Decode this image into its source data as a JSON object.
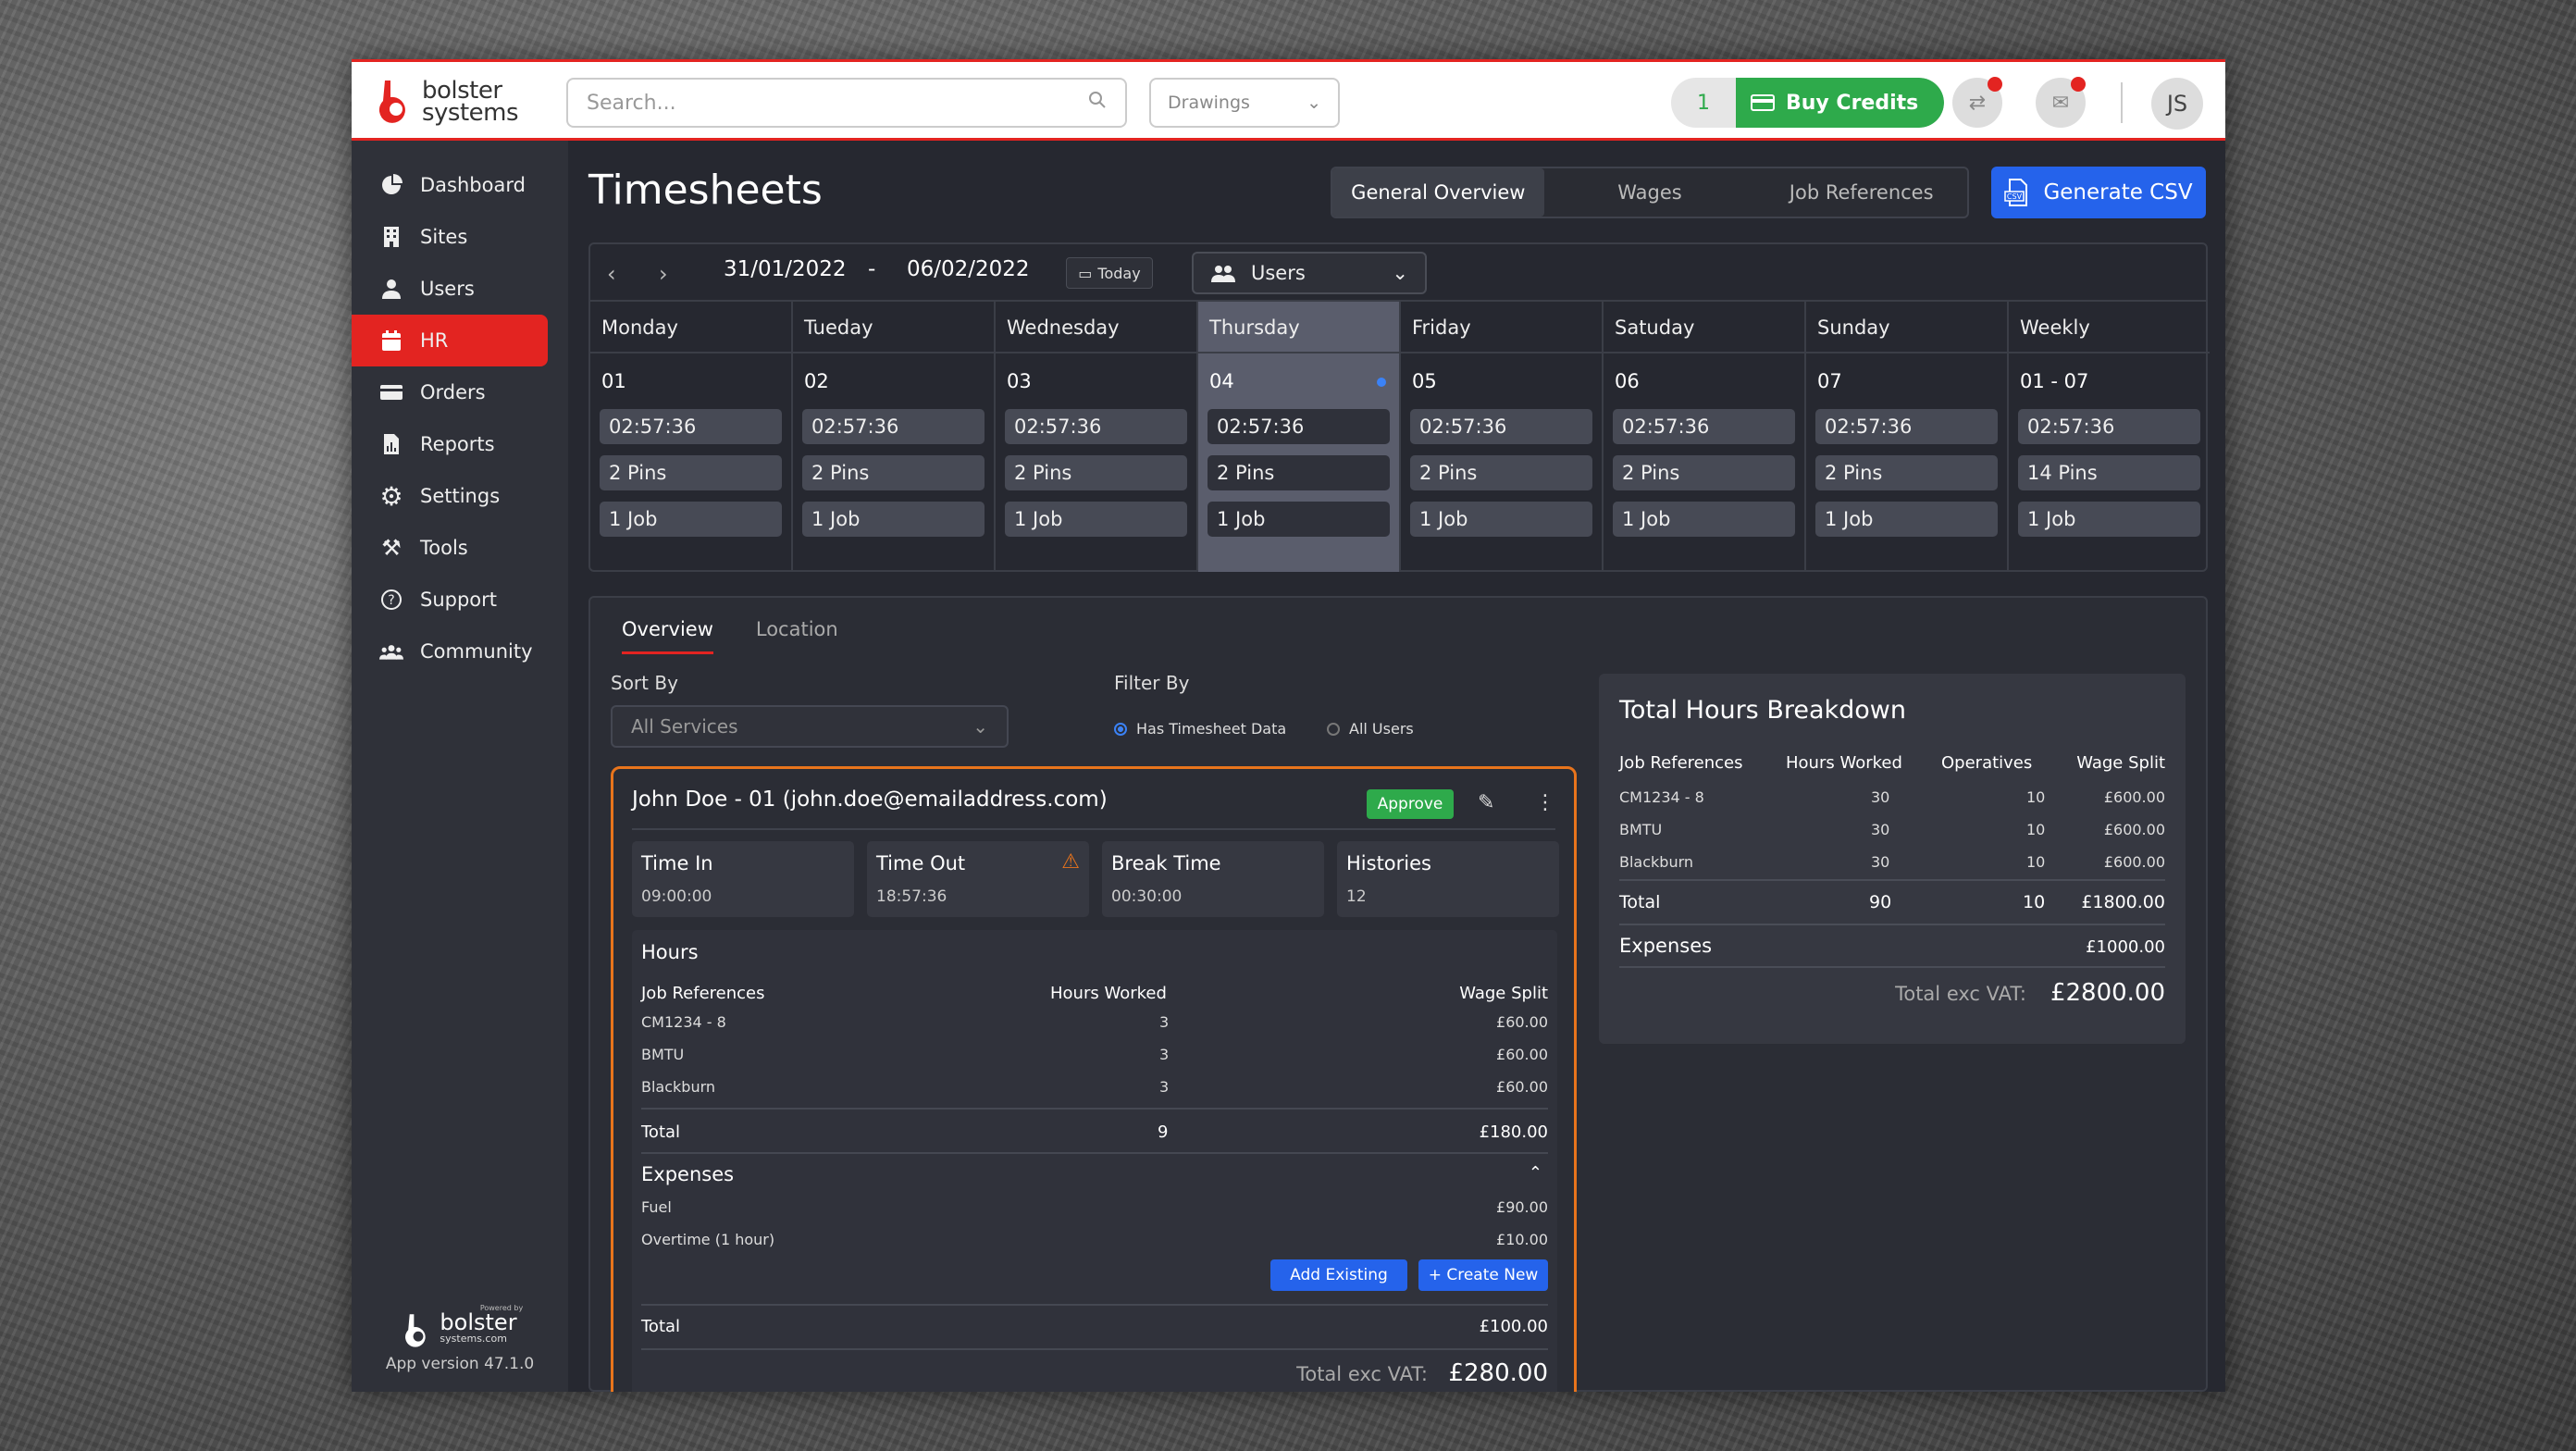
{
  "topbar": {
    "logo_line1": "bolster",
    "logo_line2": "systems",
    "search_placeholder": "Search...",
    "drawings_label": "Drawings",
    "credits_count": "1",
    "buy_credits_label": "Buy Credits",
    "avatar_initials": "JS"
  },
  "sidebar": {
    "items": [
      {
        "label": "Dashboard",
        "icon": "pie-chart-icon"
      },
      {
        "label": "Sites",
        "icon": "building-icon"
      },
      {
        "label": "Users",
        "icon": "user-icon"
      },
      {
        "label": "HR",
        "icon": "calendar-icon"
      },
      {
        "label": "Orders",
        "icon": "card-icon"
      },
      {
        "label": "Reports",
        "icon": "report-icon"
      },
      {
        "label": "Settings",
        "icon": "gear-icon"
      },
      {
        "label": "Tools",
        "icon": "tools-icon"
      },
      {
        "label": "Support",
        "icon": "help-icon"
      },
      {
        "label": "Community",
        "icon": "community-icon"
      }
    ],
    "active": "HR",
    "footer_powered": "Powered by",
    "footer_brand": "bolster",
    "footer_domain": "systems.com",
    "footer_version": "App version 47.1.0"
  },
  "page": {
    "title": "Timesheets",
    "views": [
      "General Overview",
      "Wages",
      "Job References"
    ],
    "generate_csv": "Generate CSV"
  },
  "calendar": {
    "start_date": "31/01/2022",
    "dash": "-",
    "end_date": "06/02/2022",
    "today_label": "Today",
    "users_label": "Users",
    "days": [
      {
        "name": "Monday",
        "num": "01",
        "time": "02:57:36",
        "pins": "2 Pins",
        "jobs": "1 Job"
      },
      {
        "name": "Tueday",
        "num": "02",
        "time": "02:57:36",
        "pins": "2 Pins",
        "jobs": "1 Job"
      },
      {
        "name": "Wednesday",
        "num": "03",
        "time": "02:57:36",
        "pins": "2 Pins",
        "jobs": "1 Job"
      },
      {
        "name": "Thursday",
        "num": "04",
        "time": "02:57:36",
        "pins": "2 Pins",
        "jobs": "1 Job"
      },
      {
        "name": "Friday",
        "num": "05",
        "time": "02:57:36",
        "pins": "2 Pins",
        "jobs": "1 Job"
      },
      {
        "name": "Satuday",
        "num": "06",
        "time": "02:57:36",
        "pins": "2 Pins",
        "jobs": "1 Job"
      },
      {
        "name": "Sunday",
        "num": "07",
        "time": "02:57:36",
        "pins": "2 Pins",
        "jobs": "1 Job"
      },
      {
        "name": "Weekly",
        "num": "01 - 07",
        "time": "02:57:36",
        "pins": "14 Pins",
        "jobs": "1 Job"
      }
    ],
    "selected_day": "Thursday"
  },
  "overview": {
    "tabs": [
      "Overview",
      "Location"
    ],
    "sort_by_label": "Sort By",
    "sort_by_value": "All Services",
    "filter_by_label": "Filter By",
    "filter_options": [
      "Has Timesheet Data",
      "All Users"
    ],
    "filter_selected": "Has Timesheet Data"
  },
  "card": {
    "title": "John Doe - 01 (john.doe@emailaddress.com)",
    "approve_label": "Approve",
    "time_in_label": "Time In",
    "time_in": "09:00:00",
    "time_out_label": "Time Out",
    "time_out": "18:57:36",
    "break_label": "Break Time",
    "break_time": "00:30:00",
    "histories_label": "Histories",
    "histories": "12",
    "hours_title": "Hours",
    "hours_headers": [
      "Job References",
      "Hours Worked",
      "Wage Split"
    ],
    "hours_rows": [
      [
        "CM1234 - 8",
        "3",
        "£60.00"
      ],
      [
        "BMTU",
        "3",
        "£60.00"
      ],
      [
        "Blackburn",
        "3",
        "£60.00"
      ]
    ],
    "hours_total_label": "Total",
    "hours_total": "9",
    "wage_total": "£180.00",
    "expenses_title": "Expenses",
    "expenses": [
      [
        "Fuel",
        "£90.00"
      ],
      [
        "Overtime (1 hour)",
        "£10.00"
      ]
    ],
    "add_existing": "Add Existing",
    "create_new": "+ Create New",
    "expenses_total_label": "Total",
    "expenses_total": "£100.00",
    "total_exc_vat_label": "Total exc VAT:",
    "total_exc_vat": "£280.00"
  },
  "breakdown": {
    "title": "Total Hours Breakdown",
    "headers": [
      "Job References",
      "Hours Worked",
      "Operatives",
      "Wage Split"
    ],
    "rows": [
      [
        "CM1234 - 8",
        "30",
        "10",
        "£600.00"
      ],
      [
        "BMTU",
        "30",
        "10",
        "£600.00"
      ],
      [
        "Blackburn",
        "30",
        "10",
        "£600.00"
      ]
    ],
    "total_label": "Total",
    "total_hours": "90",
    "total_operatives": "10",
    "total_wage": "£1800.00",
    "expenses_label": "Expenses",
    "expenses_value": "£1000.00",
    "total_exc_vat_label": "Total exc VAT:",
    "total_exc_vat": "£2800.00"
  },
  "colors": {
    "brand_red": "#e32421",
    "accent_blue": "#2563eb",
    "green": "#2eaa4b",
    "card_border": "#e8741c"
  }
}
